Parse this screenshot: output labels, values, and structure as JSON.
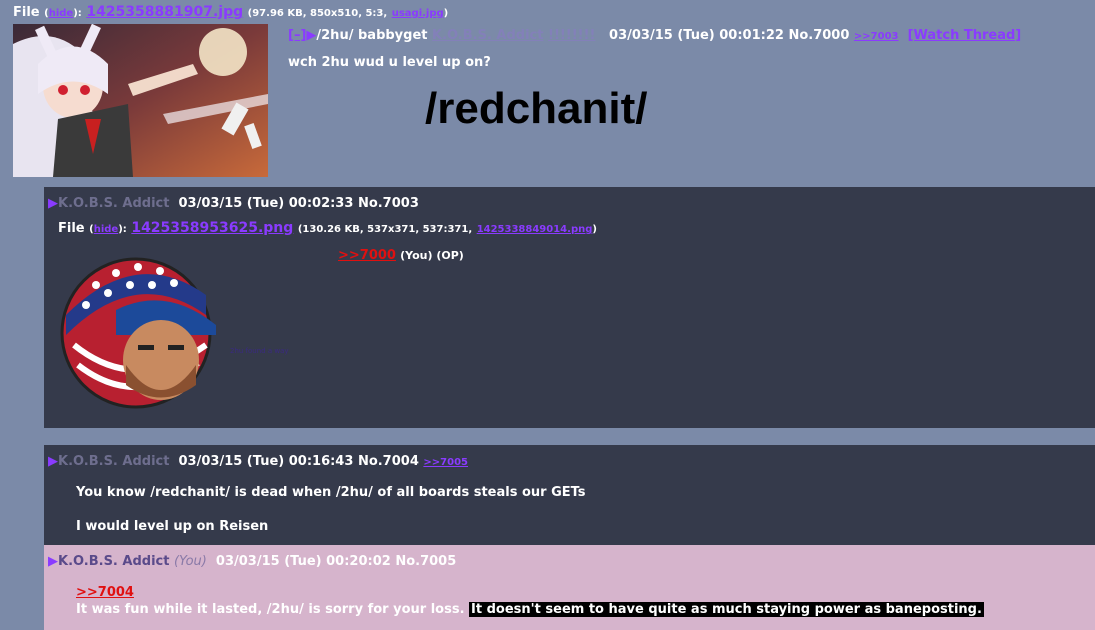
{
  "op": {
    "file_label": "File",
    "hide_link": "hide",
    "filename": "1425358881907.jpg",
    "file_meta_prefix": "(97.96 KB, 850x510, 5:3,",
    "orig_filename": "usagi.jpg",
    "file_meta_suffix": ")",
    "collapse": "[–]",
    "board": "/2hu/",
    "subject": "babbyget",
    "name": "K.O.B.S. Addict",
    "tripcode": "!!!!!!!!",
    "date": "03/03/15 (Tue) 00:01:22",
    "post_no": "No.7000",
    "backlink": ">>7003",
    "watch": "[Watch Thread]",
    "comment": "wch 2hu wud u level up on?",
    "big_title": "/redchanit/"
  },
  "replies": [
    {
      "name": "K.O.B.S. Addict",
      "date": "03/03/15 (Tue) 00:02:33",
      "post_no": "No.7003",
      "file_label": "File",
      "hide_link": "hide",
      "filename": "1425358953625.png",
      "file_meta_prefix": "(130.26 KB, 537x371, 537:371,",
      "orig_filename": "1425338849014.png",
      "file_meta_suffix": ")",
      "quote": ">>7000",
      "quote_suffix": "(You) (OP)",
      "image_caption": "2hu found a way"
    },
    {
      "name": "K.O.B.S. Addict",
      "date": "03/03/15 (Tue) 00:16:43",
      "post_no": "No.7004",
      "backlink": ">>7005",
      "line1": "You know /redchanit/ is dead when /2hu/ of all boards steals our GETs",
      "line2": "I would level up on Reisen"
    },
    {
      "name": "K.O.B.S. Addict",
      "you": "(You)",
      "date": "03/03/15 (Tue) 00:20:02",
      "post_no": "No.7005",
      "quote": ">>7004",
      "text": "It was fun while it lasted, /2hu/ is sorry for your loss.",
      "spoiler": "It doesn't seem to have quite as much staying power as baneposting."
    }
  ],
  "colors": {
    "page_bg": "#7b8aa8",
    "reply_bg": "#353a4b",
    "highlight_bg": "#d6b4cc",
    "link": "#8a3bff",
    "quote": "#e01010"
  }
}
